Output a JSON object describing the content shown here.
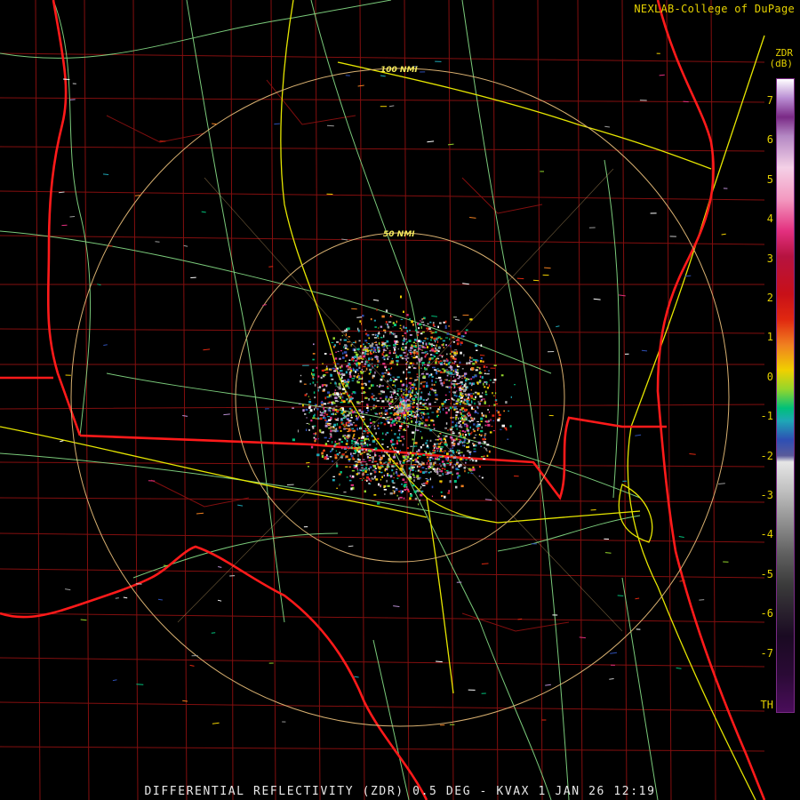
{
  "credit": "NEXLAB-College of DuPage",
  "caption": "DIFFERENTIAL REFLECTIVITY (ZDR) 0.5 DEG - KVAX 1 JAN 26 12:19",
  "legend": {
    "title": "ZDR",
    "units": "(dB)",
    "ticks": [
      "7",
      "6",
      "5",
      "4",
      "3",
      "2",
      "1",
      "0",
      "-1",
      "-2",
      "-3",
      "-4",
      "-5",
      "-6",
      "-7",
      "TH"
    ]
  },
  "rings": {
    "inner": "50 NMI",
    "outer": "100 NMI"
  },
  "colors": {
    "state_border": "#ff1a1a",
    "county_border": "#9a1212",
    "interstate": "#e6e600",
    "highway": "#88e088",
    "range_ring": "#d8b070",
    "text": "#e6d200"
  }
}
